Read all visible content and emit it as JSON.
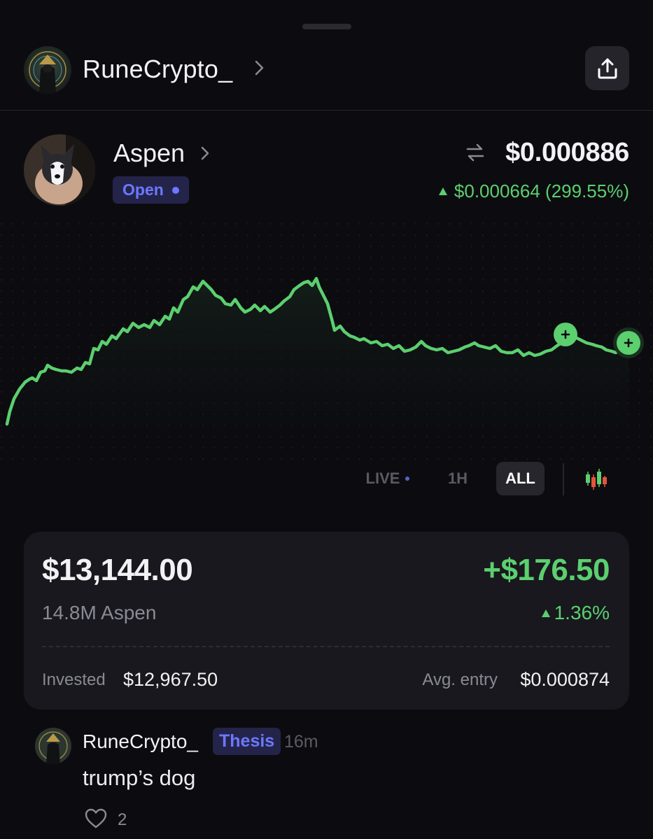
{
  "header": {
    "username": "RuneCrypto_",
    "share_icon": "share-upload-icon"
  },
  "token": {
    "name": "Aspen",
    "status": "Open",
    "price": "$0.000886",
    "change": "$0.000664 (299.55%)",
    "swap_icon": "swap-arrows-icon"
  },
  "timeframes": {
    "live": "LIVE",
    "h1": "1H",
    "all": "ALL",
    "selected": "ALL"
  },
  "position": {
    "value": "$13,144.00",
    "pnl": "+$176.50",
    "quantity": "14.8M Aspen",
    "pnl_percent": "1.36%",
    "invested_label": "Invested",
    "invested_value": "$12,967.50",
    "avg_entry_label": "Avg. entry",
    "avg_entry_value": "$0.000874"
  },
  "comment": {
    "author": "RuneCrypto_",
    "tag": "Thesis",
    "time": "16m",
    "text": "trump’s dog",
    "likes": "2"
  },
  "colors": {
    "background": "#0c0c10",
    "accent_green": "#5ccf6f",
    "accent_purple": "#6c78ff",
    "card": "#18181e"
  }
}
